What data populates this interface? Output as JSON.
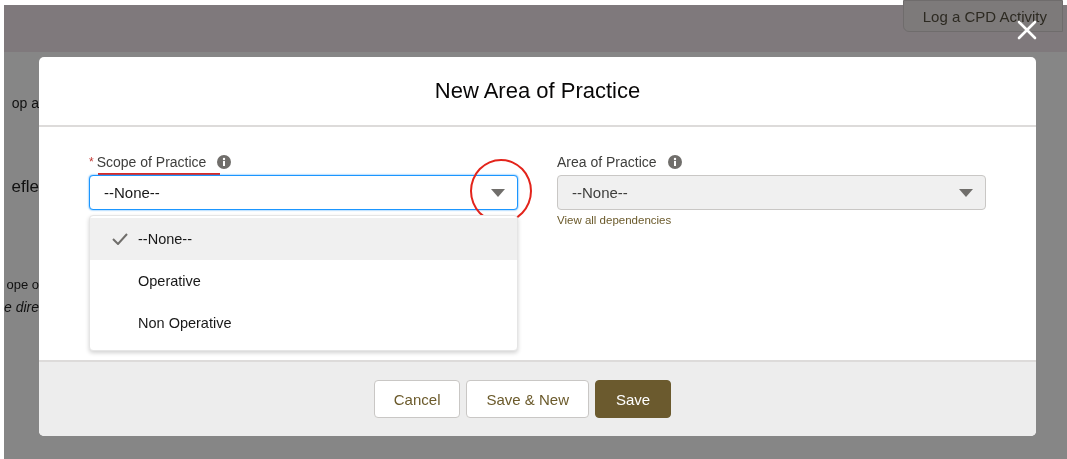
{
  "background": {
    "button": "Log a CPD Activity",
    "fragments": [
      {
        "text": "op a",
        "kind": "plain"
      },
      {
        "text": "efle",
        "kind": "heading"
      },
      {
        "text": "ope o",
        "kind": "plain"
      },
      {
        "text": "e dire",
        "kind": "italic"
      }
    ]
  },
  "modal": {
    "title": "New Area of Practice",
    "fields": [
      {
        "label": "Scope of Practice",
        "required": true,
        "required_marker": "*",
        "value": "--None--",
        "focused": true,
        "disabled": false,
        "open": true,
        "options": [
          {
            "label": "--None--",
            "selected": true
          },
          {
            "label": "Operative",
            "selected": false
          },
          {
            "label": "Non Operative",
            "selected": false
          }
        ]
      },
      {
        "label": "Area of Practice",
        "required": false,
        "value": "--None--",
        "focused": false,
        "disabled": true,
        "open": false,
        "link": "View all dependencies"
      }
    ],
    "buttons": [
      {
        "label": "Cancel",
        "kind": "neutral"
      },
      {
        "label": "Save & New",
        "kind": "neutral"
      },
      {
        "label": "Save",
        "kind": "brand"
      }
    ]
  }
}
